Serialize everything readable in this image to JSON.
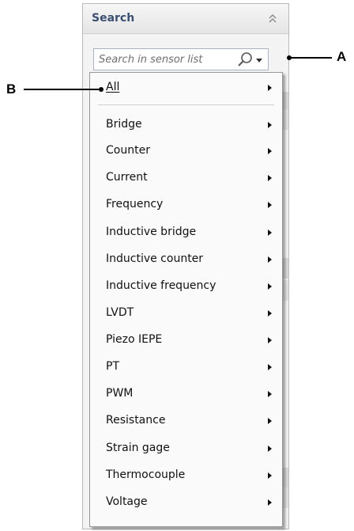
{
  "panel": {
    "title": "Search",
    "collapse_icon": "double-chevron-up-icon",
    "search_placeholder": "Search in sensor list",
    "search_icon": "search-icon",
    "dropdown_icon": "triangle-down-icon"
  },
  "menu": {
    "items": [
      {
        "label": "All"
      },
      {
        "label": "Bridge"
      },
      {
        "label": "Counter"
      },
      {
        "label": "Current"
      },
      {
        "label": "Frequency"
      },
      {
        "label": "Inductive bridge"
      },
      {
        "label": "Inductive counter"
      },
      {
        "label": "Inductive frequency"
      },
      {
        "label": "LVDT"
      },
      {
        "label": "Piezo IEPE"
      },
      {
        "label": "PT"
      },
      {
        "label": "PWM"
      },
      {
        "label": "Resistance"
      },
      {
        "label": "Strain gage"
      },
      {
        "label": "Thermocouple"
      },
      {
        "label": "Voltage"
      }
    ],
    "submenu_icon": "triangle-right-icon"
  },
  "callouts": {
    "a": "A",
    "b": "B"
  },
  "colors": {
    "title_text": "#3b4f72",
    "search_border": "#a9b3c3",
    "menu_border": "#979797"
  }
}
